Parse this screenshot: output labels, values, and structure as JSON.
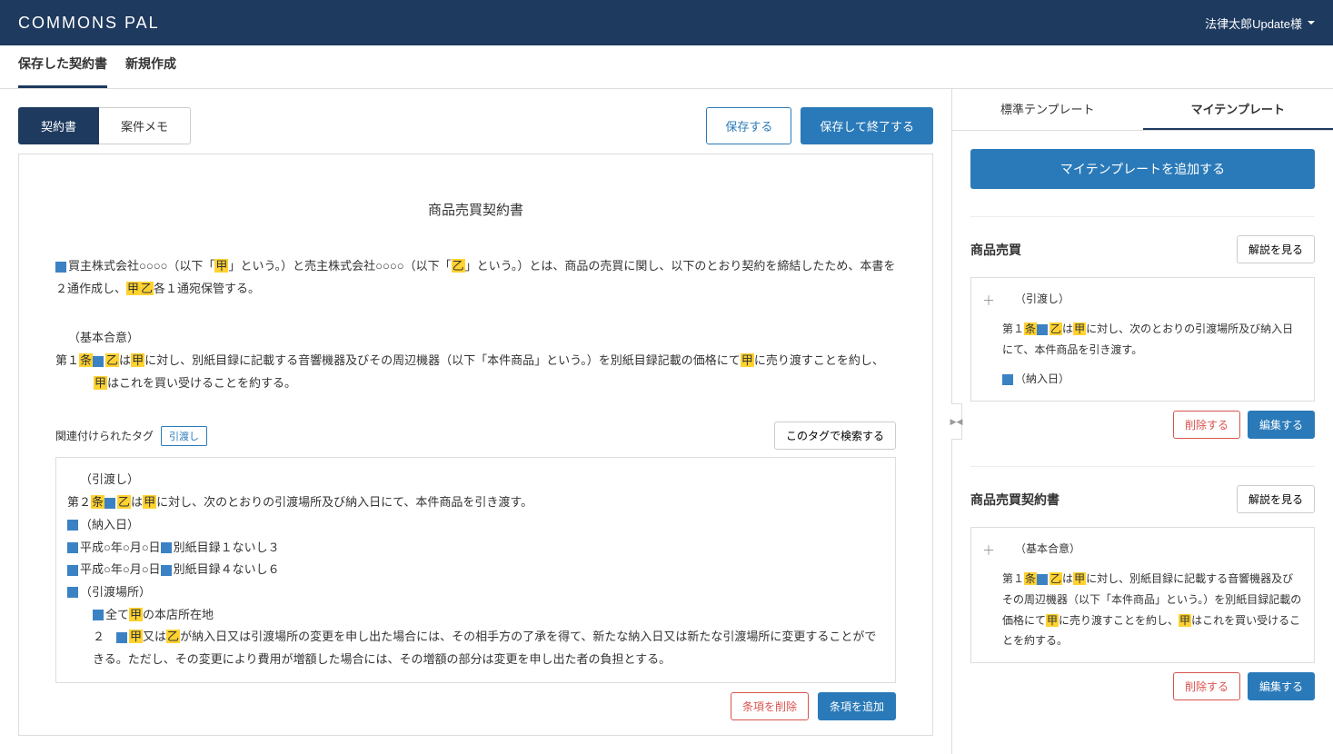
{
  "header": {
    "logo": "COMMONS PAL",
    "user": "法律太郎Update様"
  },
  "nav": {
    "tab1": "保存した契約書",
    "tab2": "新規作成"
  },
  "subtabs": {
    "contract": "契約書",
    "memo": "案件メモ"
  },
  "actions": {
    "save": "保存する",
    "saveExit": "保存して終了する"
  },
  "doc": {
    "title": "商品売買契約書",
    "p1_a": "買主株式会社○○○○（以下「",
    "p1_hl1": "甲",
    "p1_b": "」という。）と売主株式会社○○○○（以下「",
    "p1_hl2": "乙",
    "p1_c": "」という。）とは、商品の売買に関し、以下のとおり契約を締結したため、本書を２通作成し、",
    "p1_hl3": "甲",
    "p1_hl4": "乙",
    "p1_d": "各１通宛保管する。",
    "p2_head": "（基本合意）",
    "p2_a": "第１",
    "p2_hl1": "条",
    "p2_hl2": "乙",
    "p2_b": "は",
    "p2_hl3": "甲",
    "p2_c": "に対し、別紙目録に記載する音響機器及びその周辺機器（以下「本件商品」という。）を別紙目録記載の価格にて",
    "p2_hl4": "甲",
    "p2_d": "に売り渡すことを約し、",
    "p2_hl5": "甲",
    "p2_e": "はこれを買い受けることを約する。"
  },
  "tags": {
    "label": "関連付けられたタグ",
    "chip": "引渡し",
    "search": "このタグで検索する",
    "body": {
      "l1": "（引渡し）",
      "l2a": "第２",
      "l2hl1": "条",
      "l2hl2": "乙",
      "l2b": "は",
      "l2hl3": "甲",
      "l2c": "に対し、次のとおりの引渡場所及び納入日にて、本件商品を引き渡す。",
      "l3": "（納入日）",
      "l4": "平成○年○月○日",
      "l4b": "別紙目録１ないし３",
      "l5": "平成○年○月○日",
      "l5b": "別紙目録４ないし６",
      "l6": "（引渡場所）",
      "l7a": "全て",
      "l7hl": "甲",
      "l7b": "の本店所在地",
      "l8a": "２　",
      "l8hl1": "甲",
      "l8b": "又は",
      "l8hl2": "乙",
      "l8c": "が納入日又は引渡場所の変更を申し出た場合には、その相手方の了承を得て、新たな納入日又は新たな引渡場所に変更することができる。ただし、その変更により費用が増額した場合には、その増額の部分は変更を申し出た者の負担とする。"
    },
    "deleteArticle": "条項を削除",
    "addArticle": "条項を追加"
  },
  "right": {
    "tab1": "標準テンプレート",
    "tab2": "マイテンプレート",
    "addBtn": "マイテンプレートを追加する",
    "explain": "解説を見る",
    "delete": "削除する",
    "edit": "編集する",
    "tpl1": {
      "title": "商品売買",
      "head": "（引渡し）",
      "t_a": "第１",
      "t_hl1": "条",
      "t_hl2": "乙",
      "t_b": "は",
      "t_hl3": "甲",
      "t_c": "に対し、次のとおりの引渡場所及び納入日にて、本件商品を引き渡す。",
      "t_sub": "（納入日）"
    },
    "tpl2": {
      "title": "商品売買契約書",
      "head": "（基本合意）",
      "t_a": "第１",
      "t_hl1": "条",
      "t_hl2": "乙",
      "t_b": "は",
      "t_hl3": "甲",
      "t_c": "に対し、別紙目録に記載する音響機器及びその周辺機器（以下「本件商品」という。）を別紙目録記載の価格にて",
      "t_hl4": "甲",
      "t_d": "に売り渡すことを約し、",
      "t_hl5": "甲",
      "t_e": "はこれを買い受けることを約する。"
    }
  }
}
